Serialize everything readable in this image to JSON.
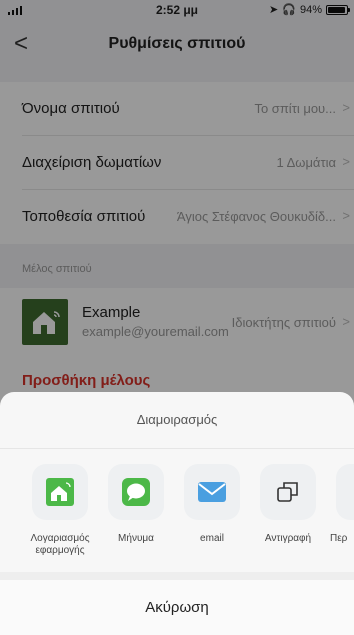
{
  "status_bar": {
    "time": "2:52 μμ",
    "battery": "94%"
  },
  "nav": {
    "title": "Ρυθμίσεις σπιτιού",
    "back": "<"
  },
  "settings": [
    {
      "label": "Όνομα σπιτιού",
      "value": "Το σπίτι μου..."
    },
    {
      "label": "Διαχείριση δωματίων",
      "value": "1 Δωμάτια"
    },
    {
      "label": "Τοποθεσία σπιτιού",
      "value": "Άγιος Στέφανος Θουκυδίδ..."
    }
  ],
  "members_section": {
    "header": "Μέλος σπιτιού"
  },
  "member": {
    "name": "Example",
    "email": "example@youremail.com",
    "role": "Ιδιοκτήτης σπιτιού"
  },
  "add_member": {
    "label": "Προσθήκη μέλους"
  },
  "share_sheet": {
    "title": "Διαμοιρασμός",
    "items": [
      {
        "label": "Λογαριασμός εφαρμογής",
        "icon": "app-account-icon"
      },
      {
        "label": "Μήνυμα",
        "icon": "message-icon"
      },
      {
        "label": "email",
        "icon": "mail-icon"
      },
      {
        "label": "Αντιγραφή",
        "icon": "copy-icon"
      },
      {
        "label": "Περ",
        "icon": "more-icon"
      }
    ],
    "cancel": "Ακύρωση"
  },
  "colors": {
    "accent_red": "#d9322a",
    "brand_green": "#4cb848",
    "mail_blue": "#4a9fe0"
  }
}
